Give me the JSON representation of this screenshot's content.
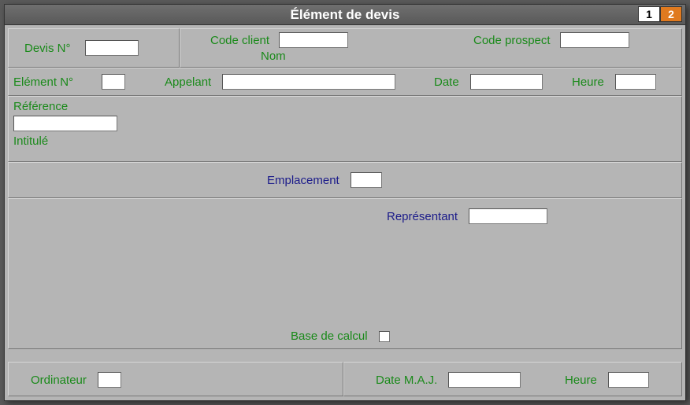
{
  "title": "Élément de devis",
  "pages": {
    "p1": "1",
    "p2": "2"
  },
  "labels": {
    "devis_no": "Devis N°",
    "code_client": "Code client",
    "code_prospect": "Code prospect",
    "nom": "Nom",
    "element_no": "Elément N°",
    "appelant": "Appelant",
    "date": "Date",
    "heure": "Heure",
    "reference": "Référence",
    "intitule": "Intitulé",
    "emplacement": "Emplacement",
    "representant": "Représentant",
    "base_calcul": "Base de calcul",
    "ordinateur": "Ordinateur",
    "date_maj": "Date M.A.J.",
    "heure2": "Heure"
  },
  "values": {
    "devis_no": "",
    "code_client": "",
    "code_prospect": "",
    "element_no": "",
    "appelant": "",
    "date": "",
    "heure": "",
    "reference": "",
    "emplacement": "",
    "representant": "",
    "ordinateur": "",
    "date_maj": "",
    "heure2": ""
  }
}
